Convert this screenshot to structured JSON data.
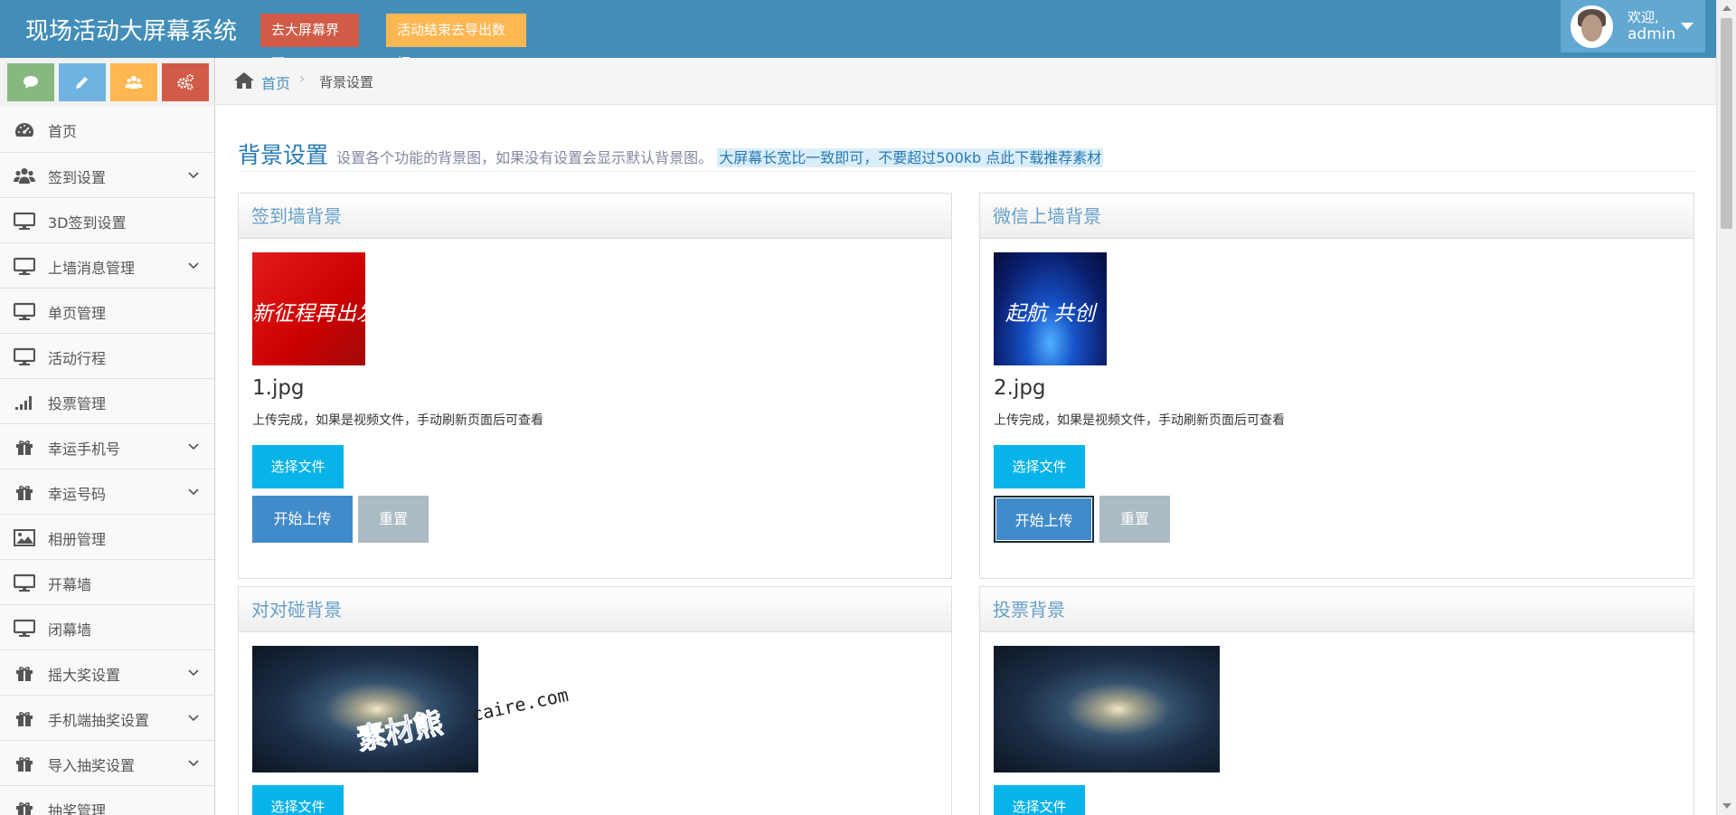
{
  "header": {
    "brand": "现场活动大屏幕系统",
    "btn_screen": "去大屏幕界面",
    "btn_export": "活动结束去导出数据",
    "welcome": "欢迎,",
    "username": "admin"
  },
  "shortcut_icons": [
    "comment-icon",
    "pencil-icon",
    "users-icon",
    "cogs-icon"
  ],
  "colors": {
    "header": "#438eb9",
    "green": "#87b87f",
    "blue": "#6fb3e0",
    "orange": "#ffb752",
    "red": "#d15b47",
    "cyan": "#08b3ea",
    "primary": "#428bca",
    "grey": "#abbac3"
  },
  "sidebar": {
    "items": [
      {
        "label": "首页",
        "icon": "dashboard-icon",
        "expandable": false
      },
      {
        "label": "签到设置",
        "icon": "users-icon",
        "expandable": true
      },
      {
        "label": "3D签到设置",
        "icon": "desktop-icon",
        "expandable": false
      },
      {
        "label": "上墙消息管理",
        "icon": "desktop-icon",
        "expandable": true
      },
      {
        "label": "单页管理",
        "icon": "desktop-icon",
        "expandable": false
      },
      {
        "label": "活动行程",
        "icon": "desktop-icon",
        "expandable": false
      },
      {
        "label": "投票管理",
        "icon": "signal-icon",
        "expandable": false
      },
      {
        "label": "幸运手机号",
        "icon": "gift-icon",
        "expandable": true
      },
      {
        "label": "幸运号码",
        "icon": "gift-icon",
        "expandable": true
      },
      {
        "label": "相册管理",
        "icon": "picture-icon",
        "expandable": false
      },
      {
        "label": "开幕墙",
        "icon": "desktop-icon",
        "expandable": false
      },
      {
        "label": "闭幕墙",
        "icon": "desktop-icon",
        "expandable": false
      },
      {
        "label": "摇大奖设置",
        "icon": "gift-icon",
        "expandable": true
      },
      {
        "label": "手机端抽奖设置",
        "icon": "gift-icon",
        "expandable": true
      },
      {
        "label": "导入抽奖设置",
        "icon": "gift-icon",
        "expandable": true
      },
      {
        "label": "抽奖管理",
        "icon": "gift-icon",
        "expandable": false
      }
    ]
  },
  "breadcrumb": {
    "home": "首页",
    "current": "背景设置"
  },
  "page": {
    "title": "背景设置",
    "subtitle": "设置各个功能的背景图，如果没有设置会显示默认背景图。",
    "highlight": "大屏幕长宽比一致即可，不要超过500kb 点此下载推荐素材"
  },
  "cards": [
    {
      "title": "签到墙背景",
      "thumb_text": "新征程再出发",
      "filename": "1.jpg",
      "note": "上传完成，如果是视频文件，手动刷新页面后可查看",
      "choose": "选择文件",
      "upload": "开始上传",
      "reset": "重置"
    },
    {
      "title": "微信上墙背景",
      "thumb_text": "起航 共创",
      "filename": "2.jpg",
      "note": "上传完成，如果是视频文件，手动刷新页面后可查看",
      "choose": "选择文件",
      "upload": "开始上传",
      "reset": "重置"
    },
    {
      "title": "对对碰背景",
      "choose": "选择文件"
    },
    {
      "title": "投票背景",
      "choose": "选择文件"
    }
  ],
  "watermark": {
    "logo": "素材熊",
    "url": "caire.com"
  }
}
